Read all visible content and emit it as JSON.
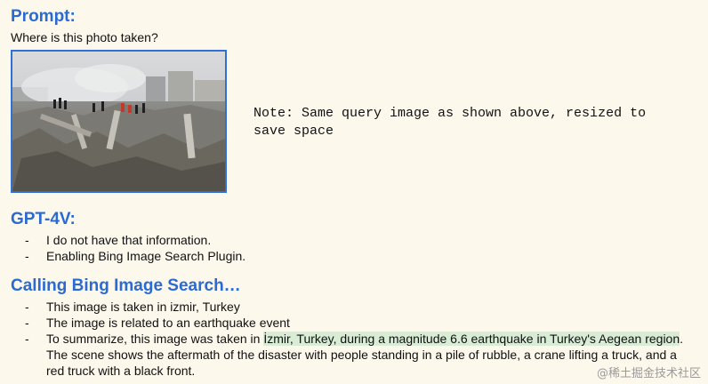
{
  "prompt": {
    "heading": "Prompt:",
    "question": "Where is this photo taken?"
  },
  "note": "Note: Same query image as shown above, resized to save space",
  "gpt4v": {
    "heading": "GPT-4V:",
    "bullets": [
      "I do not have that information.",
      "Enabling Bing Image Search Plugin."
    ]
  },
  "bing": {
    "heading": "Calling Bing Image Search…",
    "bullets": [
      "This image is taken in izmir, Turkey",
      "The image is related to an earthquake event"
    ],
    "summary_pre": "To summarize, this image was taken in ",
    "summary_highlight": "İzmir, Turkey, during a magnitude 6.6 earthquake in Turkey's Aegean region",
    "summary_post": ". The scene shows the aftermath of the disaster with people standing in a pile of rubble, a crane lifting a truck, and a red truck with a black front."
  },
  "dash": "-",
  "watermark": "@稀土掘金技术社区",
  "colors": {
    "heading": "#2a6ad2",
    "background": "#fdf8ec",
    "highlight": "#d9ecd6",
    "photo_border": "#2f6fd6"
  }
}
